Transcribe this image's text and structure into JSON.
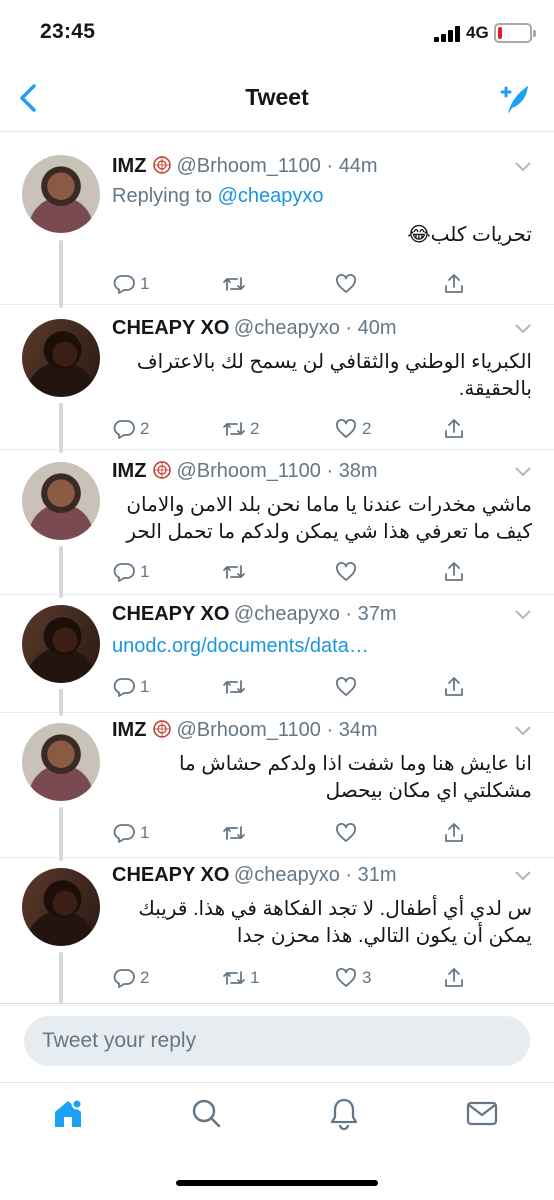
{
  "status_bar": {
    "time": "23:45",
    "network": "4G"
  },
  "header": {
    "title": "Tweet"
  },
  "tweets": [
    {
      "name": "IMZ",
      "handle": "@Brhoom_1100",
      "time": "44m",
      "replying_label": "Replying to",
      "replying_to": "@cheapyxo",
      "text": "تحريات كلب😂",
      "counts": {
        "reply": "1",
        "retweet": "",
        "like": ""
      }
    },
    {
      "name": "CHEAPY XO",
      "handle": "@cheapyxo",
      "time": "40m",
      "text": "الكبرياء الوطني والثقافي لن يسمح لك بالاعتراف بالحقيقة.",
      "counts": {
        "reply": "2",
        "retweet": "2",
        "like": "2"
      }
    },
    {
      "name": "IMZ",
      "handle": "@Brhoom_1100",
      "time": "38m",
      "text": "ماشي مخدرات عندنا يا ماما نحن بلد الامن والامان كيف ما تعرفي هذا شي يمكن ولدكم ما تحمل الحر",
      "counts": {
        "reply": "1",
        "retweet": "",
        "like": ""
      }
    },
    {
      "name": "CHEAPY XO",
      "handle": "@cheapyxo",
      "time": "37m",
      "link": "unodc.org/documents/data…",
      "counts": {
        "reply": "1",
        "retweet": "",
        "like": ""
      }
    },
    {
      "name": "IMZ",
      "handle": "@Brhoom_1100",
      "time": "34m",
      "text": "انا عايش هنا وما شفت اذا ولدكم حشاش ما مشكلتي اي مكان بيحصل",
      "counts": {
        "reply": "1",
        "retweet": "",
        "like": ""
      }
    },
    {
      "name": "CHEAPY XO",
      "handle": "@cheapyxo",
      "time": "31m",
      "text": "س لدي أي أطفال. لا تجد الفكاهة في هذا. قريبك يمكن أن يكون التالي. هذا محزن جدا",
      "counts": {
        "reply": "2",
        "retweet": "1",
        "like": "3"
      }
    }
  ],
  "reply_box": {
    "placeholder": "Tweet your reply"
  },
  "colors": {
    "accent": "#1da1f2",
    "link": "#1b95e0",
    "muted": "#657786",
    "battery_low": "#e0202f"
  },
  "icons": [
    "back-icon",
    "compose-icon",
    "reply-icon",
    "retweet-icon",
    "like-icon",
    "share-icon",
    "home-icon",
    "search-icon",
    "notifications-icon",
    "messages-icon"
  ]
}
